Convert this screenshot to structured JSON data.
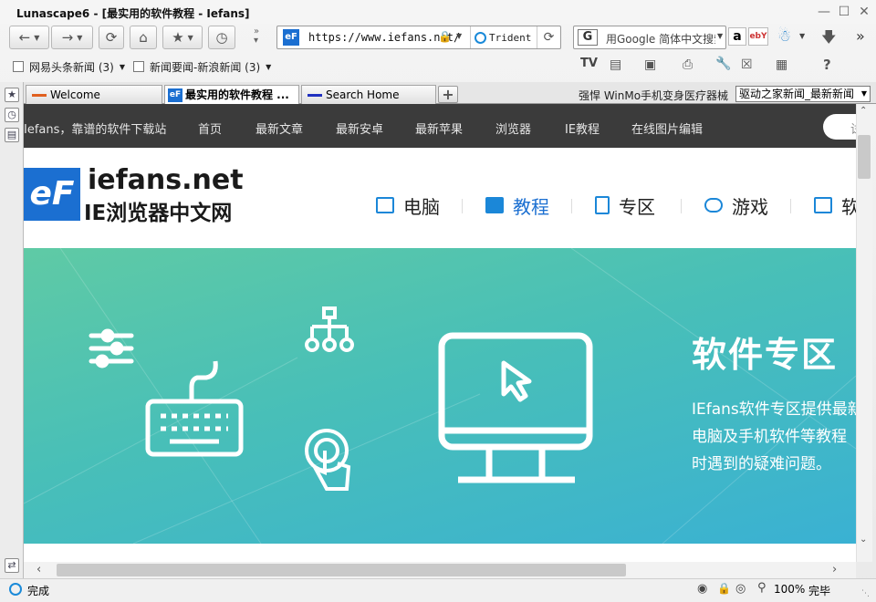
{
  "window": {
    "title": "Lunascape6 - [最实用的软件教程 - Iefans]"
  },
  "toolbar": {
    "url": "https://www.iefans.net/",
    "engine_label": "Trident",
    "search_placeholder": "用Google 简体中文搜索",
    "amazon_glyph": "a",
    "ebay_glyph": "ebY"
  },
  "bookmarks": [
    {
      "label": "网易头条新闻 (3)"
    },
    {
      "label": "新闻要闻-新浪新闻 (3)"
    }
  ],
  "tabs": [
    {
      "label": "Welcome",
      "active": false,
      "color": "#e06020"
    },
    {
      "label": "最实用的软件教程 ...",
      "active": true,
      "color": "#1b6fd1"
    },
    {
      "label": "Search Home",
      "active": false,
      "color": "#2030c0"
    }
  ],
  "tabbar": {
    "headline": "强悍 WinMo手机变身医疗器械",
    "feed_select": "驱动之家新闻_最新新闻"
  },
  "site": {
    "nav": [
      "Iefans，靠谱的软件下载站",
      "首页",
      "最新文章",
      "最新安卓",
      "最新苹果",
      "浏览器",
      "IE教程",
      "在线图片编辑"
    ],
    "search_stub": "试",
    "logo_badge": "eF",
    "logo_line1": "iefans.net",
    "logo_line2": "IE浏览器中文网",
    "main_nav": [
      "电脑",
      "教程",
      "专区",
      "游戏",
      "软"
    ],
    "banner": {
      "title": "软件专区",
      "lines": [
        "IEfans软件专区提供最新",
        "电脑及手机软件等教程",
        "时遇到的疑难问题。"
      ]
    }
  },
  "status": {
    "text": "完成",
    "zoom": "100%",
    "done": "完毕"
  },
  "colors": {
    "accent": "#1b6fd1",
    "nav_bg": "#3b3b3b",
    "banner_start": "#5fcaa5",
    "banner_end": "#3ab1d3"
  }
}
